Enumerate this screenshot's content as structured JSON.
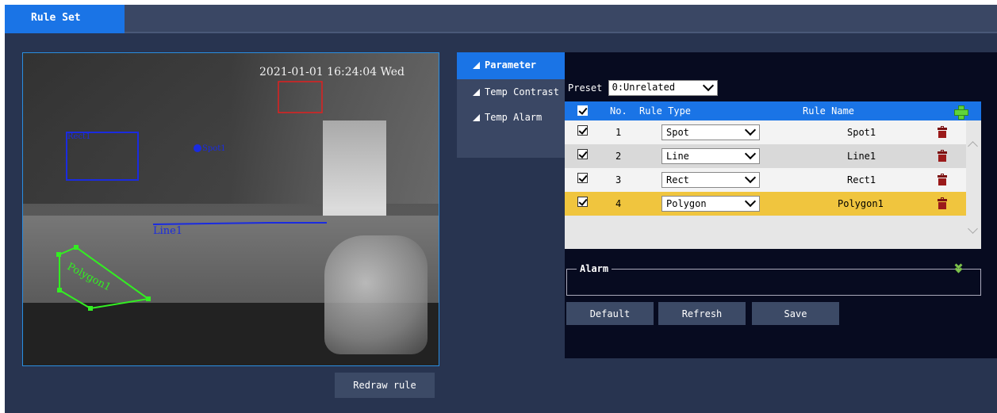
{
  "tabs": {
    "active_label": "Rule Set"
  },
  "video": {
    "osd_text": "2021-01-01 16:24:04 Wed",
    "rules": [
      {
        "label": "Rect1",
        "color": "#1a2be0"
      },
      {
        "label": "Spot1",
        "color": "#1a2be0"
      },
      {
        "label": "Line1",
        "color": "#1a2be0"
      },
      {
        "label": "Polygon1",
        "color": "#33ee22"
      }
    ]
  },
  "redraw_label": "Redraw rule",
  "submenu": [
    {
      "label": "Parameter",
      "active": true
    },
    {
      "label": "Temp Contrast",
      "active": false
    },
    {
      "label": "Temp Alarm",
      "active": false
    }
  ],
  "preset": {
    "label": "Preset",
    "value": "0:Unrelated"
  },
  "table": {
    "headers": {
      "no": "No.",
      "type": "Rule Type",
      "name": "Rule Name"
    },
    "rows": [
      {
        "no": "1",
        "type": "Spot",
        "name": "Spot1",
        "checked": true
      },
      {
        "no": "2",
        "type": "Line",
        "name": "Line1",
        "checked": true
      },
      {
        "no": "3",
        "type": "Rect",
        "name": "Rect1",
        "checked": true
      },
      {
        "no": "4",
        "type": "Polygon",
        "name": "Polygon1",
        "checked": true,
        "selected": true
      }
    ]
  },
  "alarm": {
    "title": "Alarm"
  },
  "buttons": {
    "default": "Default",
    "refresh": "Refresh",
    "save": "Save"
  },
  "colors": {
    "accent": "#1a74e6",
    "selected_row": "#f0c53e",
    "rule_blue": "#1a2be0",
    "rule_green": "#33ee22",
    "rule_red": "#e02020"
  }
}
